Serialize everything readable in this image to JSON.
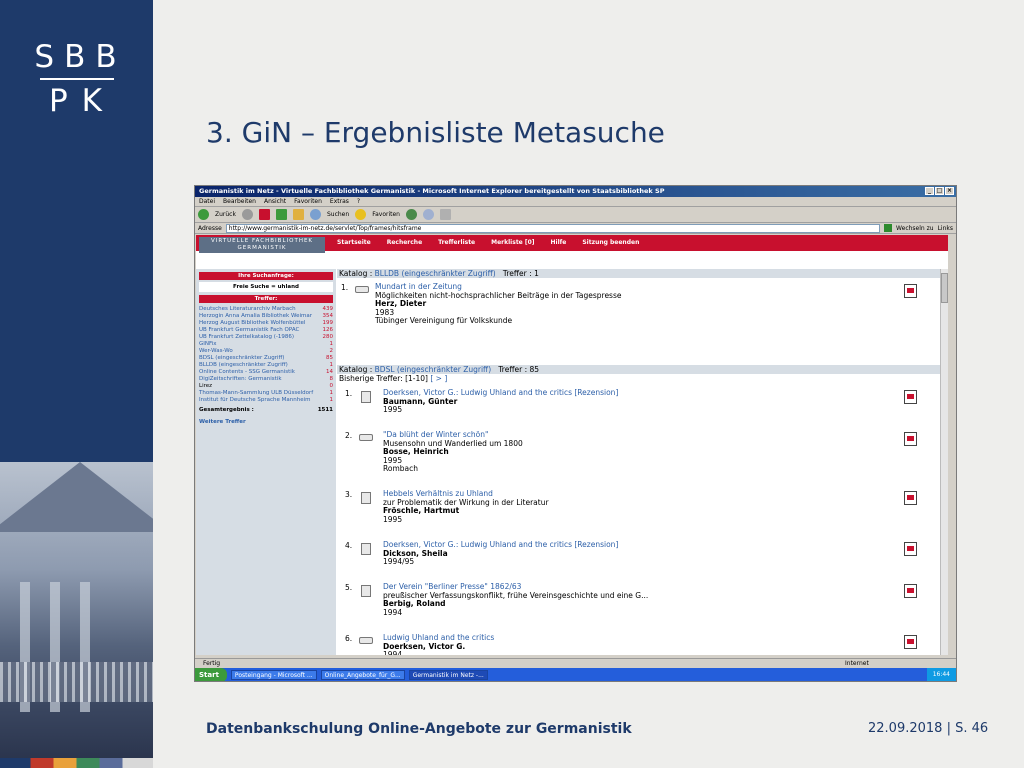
{
  "slide": {
    "logo_top": "SBB",
    "logo_bottom": "PK",
    "title": "3. GiN – Ergebnisliste Metasuche",
    "footer_left": "Datenbankschulung Online-Angebote zur Germanistik",
    "footer_right": "22.09.2018 | S. 46"
  },
  "browser": {
    "title": "Germanistik im Netz - Virtuelle Fachbibliothek Germanistik - Microsoft Internet Explorer bereitgestellt von Staatsbibliothek SP",
    "menu": [
      "Datei",
      "Bearbeiten",
      "Ansicht",
      "Favoriten",
      "Extras",
      "?"
    ],
    "toolbar": {
      "back": "Zurück",
      "search": "Suchen",
      "favorites": "Favoriten"
    },
    "address_label": "Adresse",
    "address": "http://www.germanistik-im-netz.de/servlet/Top/frames/hitsframe",
    "go_label": "Wechseln zu",
    "links_label": "Links",
    "status": "Fertig",
    "status_zone": "Internet"
  },
  "site": {
    "brand_line1": "VIRTUELLE FACHBIBLIOTHEK",
    "brand_line2": "GERMANISTIK",
    "nav": [
      "Startseite",
      "Recherche",
      "Trefferliste",
      "Merkliste [0]",
      "Hilfe",
      "Sitzung beenden"
    ]
  },
  "sidebar": {
    "request_header": "Ihre Suchanfrage:",
    "query": "Freie Suche = uhland",
    "hits_header": "Treffer:",
    "items": [
      {
        "label": "Deutsches Literaturarchiv Marbach",
        "count": "439"
      },
      {
        "label": "Herzogin Anna Amalia Bibliothek Weimar",
        "count": "354"
      },
      {
        "label": "Herzog August Bibliothek Wolfenbüttel",
        "count": "199"
      },
      {
        "label": "UB Frankfurt Germanistik Fach OPAC",
        "count": "126"
      },
      {
        "label": "UB Frankfurt Zettelkatalog (-1986)",
        "count": "280"
      },
      {
        "label": "GINFix",
        "count": "1"
      },
      {
        "label": "Wer-Was-Wo",
        "count": "2"
      },
      {
        "label": "BDSL (eingeschränkter Zugriff)",
        "count": "85"
      },
      {
        "label": "BLLDB (eingeschränkter Zugriff)",
        "count": "1"
      },
      {
        "label": "Online Contents - SSG Germanistik",
        "count": "14"
      },
      {
        "label": "DigiZeitschriften: Germanistik",
        "count": "8"
      },
      {
        "label": "Lirez",
        "count": "0"
      },
      {
        "label": "Thomas-Mann-Sammlung ULB Düsseldorf",
        "count": "1"
      },
      {
        "label": "Institut für Deutsche Sprache Mannheim",
        "count": "1"
      }
    ],
    "total_label": "Gesamtergebnis :",
    "total": "1511",
    "more": "Weitere Treffer"
  },
  "results": {
    "catalog1": {
      "label": "Katalog :",
      "name": "BLLDB (eingeschränkter Zugriff)",
      "hits_label": "Treffer :",
      "hits": "1"
    },
    "result1": {
      "num": "1.",
      "title": "Mundart in der Zeitung",
      "sub": "Möglichkeiten nicht-hochsprachlicher Beiträge in der Tagespresse",
      "author": "Herz, Dieter",
      "year": "1983",
      "extra": "Tübinger Vereinigung für Volkskunde"
    },
    "catalog2": {
      "label": "Katalog :",
      "name": "BDSL (eingeschränkter Zugriff)",
      "hits_label": "Treffer :",
      "hits": "85"
    },
    "so_far": "Bisherige Treffer: [1-10]",
    "so_far_link": "[ > ]",
    "items": [
      {
        "num": "1.",
        "title": "Doerksen, Victor G.: Ludwig Uhland and the critics [Rezension]",
        "sub": "",
        "author": "Baumann, Günter",
        "year": "1995",
        "extra": ""
      },
      {
        "num": "2.",
        "title": "\"Da blüht der Winter schön\"",
        "sub": "Musensohn und Wanderlied um 1800",
        "author": "Bosse, Heinrich",
        "year": "1995",
        "extra": "Rombach"
      },
      {
        "num": "3.",
        "title": "Hebbels Verhältnis zu Uhland",
        "sub": "zur Problematik der Wirkung in der Literatur",
        "author": "Fröschle, Hartmut",
        "year": "1995",
        "extra": ""
      },
      {
        "num": "4.",
        "title": "Doerksen, Victor G.: Ludwig Uhland and the critics [Rezension]",
        "sub": "",
        "author": "Dickson, Sheila",
        "year": "1994/95",
        "extra": ""
      },
      {
        "num": "5.",
        "title": "Der Verein \"Berliner Presse\" 1862/63",
        "sub": "preußischer Verfassungskonflikt, frühe Vereinsgeschichte und eine G...",
        "author": "Berbig, Roland",
        "year": "1994",
        "extra": ""
      },
      {
        "num": "6.",
        "title": "Ludwig Uhland and the critics",
        "sub": "",
        "author": "Doerksen, Victor G.",
        "year": "1994",
        "extra": ""
      }
    ]
  },
  "taskbar": {
    "start": "Start",
    "tasks": [
      "Posteingang - Microsoft ...",
      "Online_Angebote_für_G...",
      "Germanistik im Netz -..."
    ],
    "clock": "16:44"
  }
}
